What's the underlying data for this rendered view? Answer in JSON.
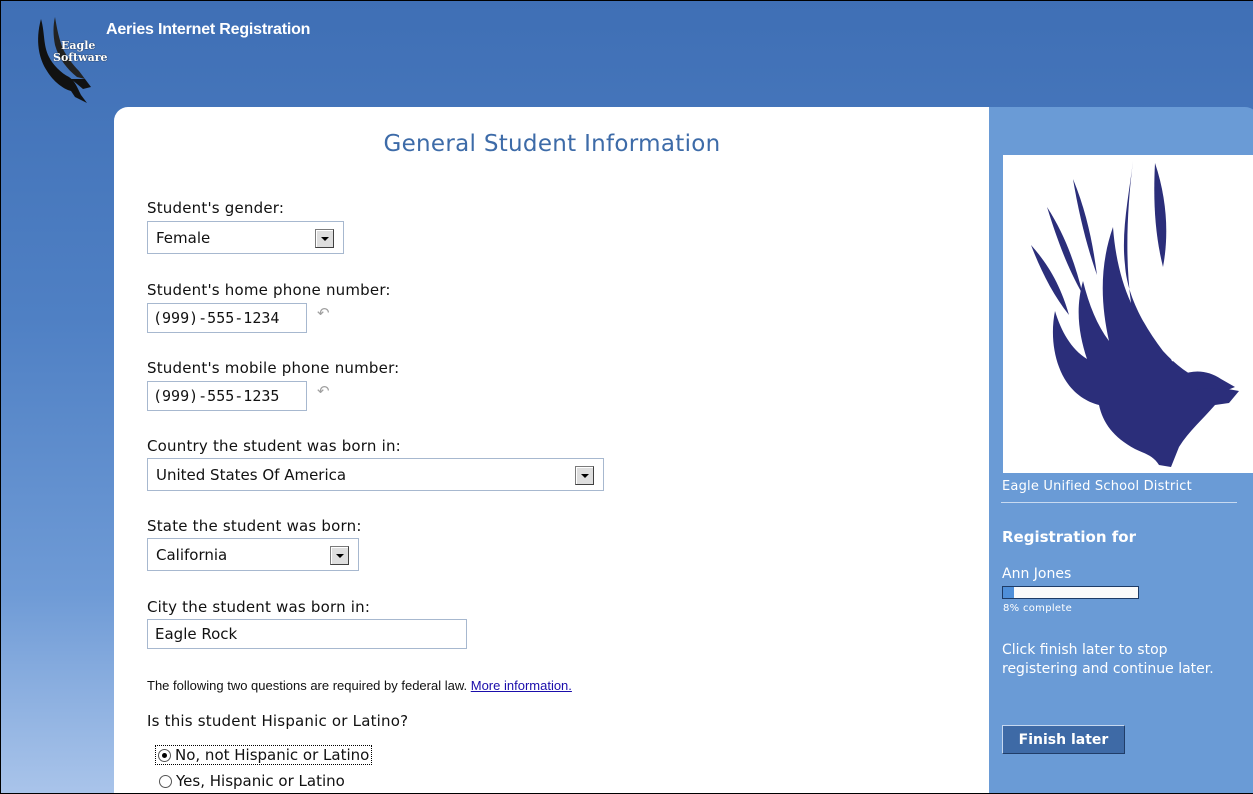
{
  "app": {
    "title": "Aeries Internet Registration",
    "logo_text_top": "Eagle",
    "logo_text_bottom": "Software"
  },
  "form": {
    "title": "General Student Information",
    "gender": {
      "label": "Student's gender:",
      "value": "Female"
    },
    "home_phone": {
      "label": "Student's home phone number:",
      "value": "(999)-555-1234"
    },
    "mobile_phone": {
      "label": "Student's mobile phone number:",
      "value": "(999)-555-1235"
    },
    "country": {
      "label": "Country the student was born in:",
      "value": "United States Of America"
    },
    "state": {
      "label": "State the student was born:",
      "value": "California"
    },
    "city": {
      "label": "City the student was born in:",
      "value": "Eagle Rock"
    },
    "federal_notice": "The following two questions are required by federal law.",
    "more_info_link": "More information.",
    "hispanic": {
      "question": "Is this student Hispanic or Latino?",
      "options": [
        {
          "label": "No, not Hispanic or Latino",
          "checked": true
        },
        {
          "label": "Yes, Hispanic or Latino",
          "checked": false
        }
      ]
    }
  },
  "sidebar": {
    "district": "Eagle Unified School District",
    "registration_for": "Registration for",
    "student_name": "Ann Jones",
    "progress_fraction": 0.08,
    "progress_text": "8% complete",
    "hint": "Click finish later to stop registering and continue later.",
    "finish_button": "Finish later"
  },
  "colors": {
    "accent": "#3d6ba8",
    "sidebar": "#6a9bd6",
    "eagle": "#2b2e7a"
  },
  "icons": [
    "eagle-logo-icon",
    "dropdown-arrow-icon",
    "undo-icon",
    "eagle-mascot-icon"
  ]
}
